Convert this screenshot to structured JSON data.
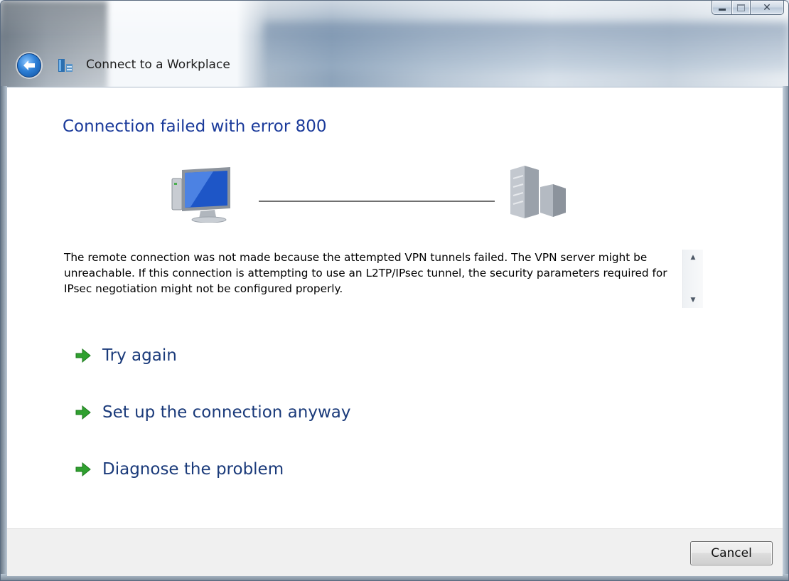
{
  "window": {
    "title": "Connect to a Workplace",
    "icons": {
      "back": "back-arrow-icon",
      "app": "network-connection-icon"
    }
  },
  "caption_buttons": {
    "minimize": "minimize-icon",
    "maximize": "maximize-icon",
    "close": "close-icon"
  },
  "content": {
    "heading": "Connection failed with error 800",
    "diagram": {
      "left_icon": "computer-monitor-icon",
      "right_icon": "server-building-icon"
    },
    "message": "The remote connection was not made because the attempted VPN tunnels failed. The VPN server might be unreachable. If this connection is attempting to use an L2TP/IPsec tunnel, the security parameters required for IPsec negotiation might not be configured properly.",
    "options": [
      {
        "label": "Try again",
        "icon": "green-arrow-icon"
      },
      {
        "label": "Set up the connection anyway",
        "icon": "green-arrow-icon"
      },
      {
        "label": "Diagnose the problem",
        "icon": "green-arrow-icon"
      }
    ]
  },
  "footer": {
    "cancel_label": "Cancel"
  },
  "colors": {
    "heading": "#1a3a9a",
    "option_text": "#1a3a7a",
    "arrow_green": "#2fa02f"
  }
}
